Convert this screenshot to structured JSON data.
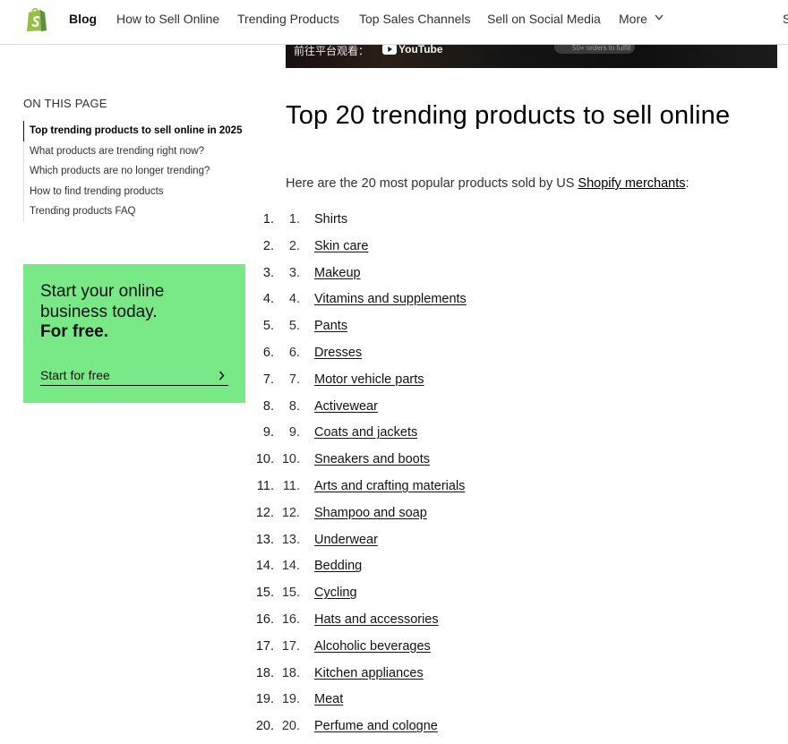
{
  "nav": {
    "links": [
      "Blog",
      "How to Sell Online",
      "Trending Products",
      "Top Sales Channels",
      "Sell on Social Media",
      "More"
    ],
    "cut_text": "S"
  },
  "video": {
    "watch_text": "前往平台观看：",
    "youtube_text": "YouTube",
    "pill_text": "50+ orders to fulfill"
  },
  "toc": {
    "heading": "ON THIS PAGE",
    "items": [
      "Top trending products to sell online in 2025",
      "What products are trending right now?",
      "Which products are no longer trending?",
      "How to find trending products",
      "Trending products FAQ"
    ]
  },
  "cta": {
    "line1": "Start your online",
    "line2": "business today.",
    "line3": "For free.",
    "link": "Start for free",
    "bg_color": "#79e886"
  },
  "main": {
    "title": "Top 20 trending products to sell online",
    "intro_prefix": "Here are the 20 most popular products sold by US ",
    "intro_link": "Shopify merchants",
    "intro_suffix": ":",
    "products": [
      {
        "num": "1.",
        "name": "Shirts",
        "linked": false
      },
      {
        "num": "2.",
        "name": "Skin care",
        "linked": true
      },
      {
        "num": "3.",
        "name": "Makeup",
        "linked": true
      },
      {
        "num": "4.",
        "name": "Vitamins and supplements",
        "linked": true
      },
      {
        "num": "5.",
        "name": "Pants",
        "linked": true
      },
      {
        "num": "6.",
        "name": "Dresses",
        "linked": true
      },
      {
        "num": "7.",
        "name": "Motor vehicle parts",
        "linked": true
      },
      {
        "num": "8.",
        "name": "Activewear",
        "linked": true
      },
      {
        "num": "9.",
        "name": "Coats and jackets",
        "linked": true
      },
      {
        "num": "10.",
        "name": "Sneakers and boots",
        "linked": true
      },
      {
        "num": "11.",
        "name": "Arts and crafting materials",
        "linked": true
      },
      {
        "num": "12.",
        "name": "Shampoo and soap",
        "linked": true
      },
      {
        "num": "13.",
        "name": "Underwear",
        "linked": true
      },
      {
        "num": "14.",
        "name": "Bedding",
        "linked": true
      },
      {
        "num": "15.",
        "name": "Cycling",
        "linked": true
      },
      {
        "num": "16.",
        "name": "Hats and accessories",
        "linked": true
      },
      {
        "num": "17.",
        "name": "Alcoholic beverages",
        "linked": true
      },
      {
        "num": "18.",
        "name": "Kitchen appliances",
        "linked": true
      },
      {
        "num": "19.",
        "name": "Meat",
        "linked": true
      },
      {
        "num": "20.",
        "name": "Perfume and cologne",
        "linked": true
      }
    ]
  }
}
